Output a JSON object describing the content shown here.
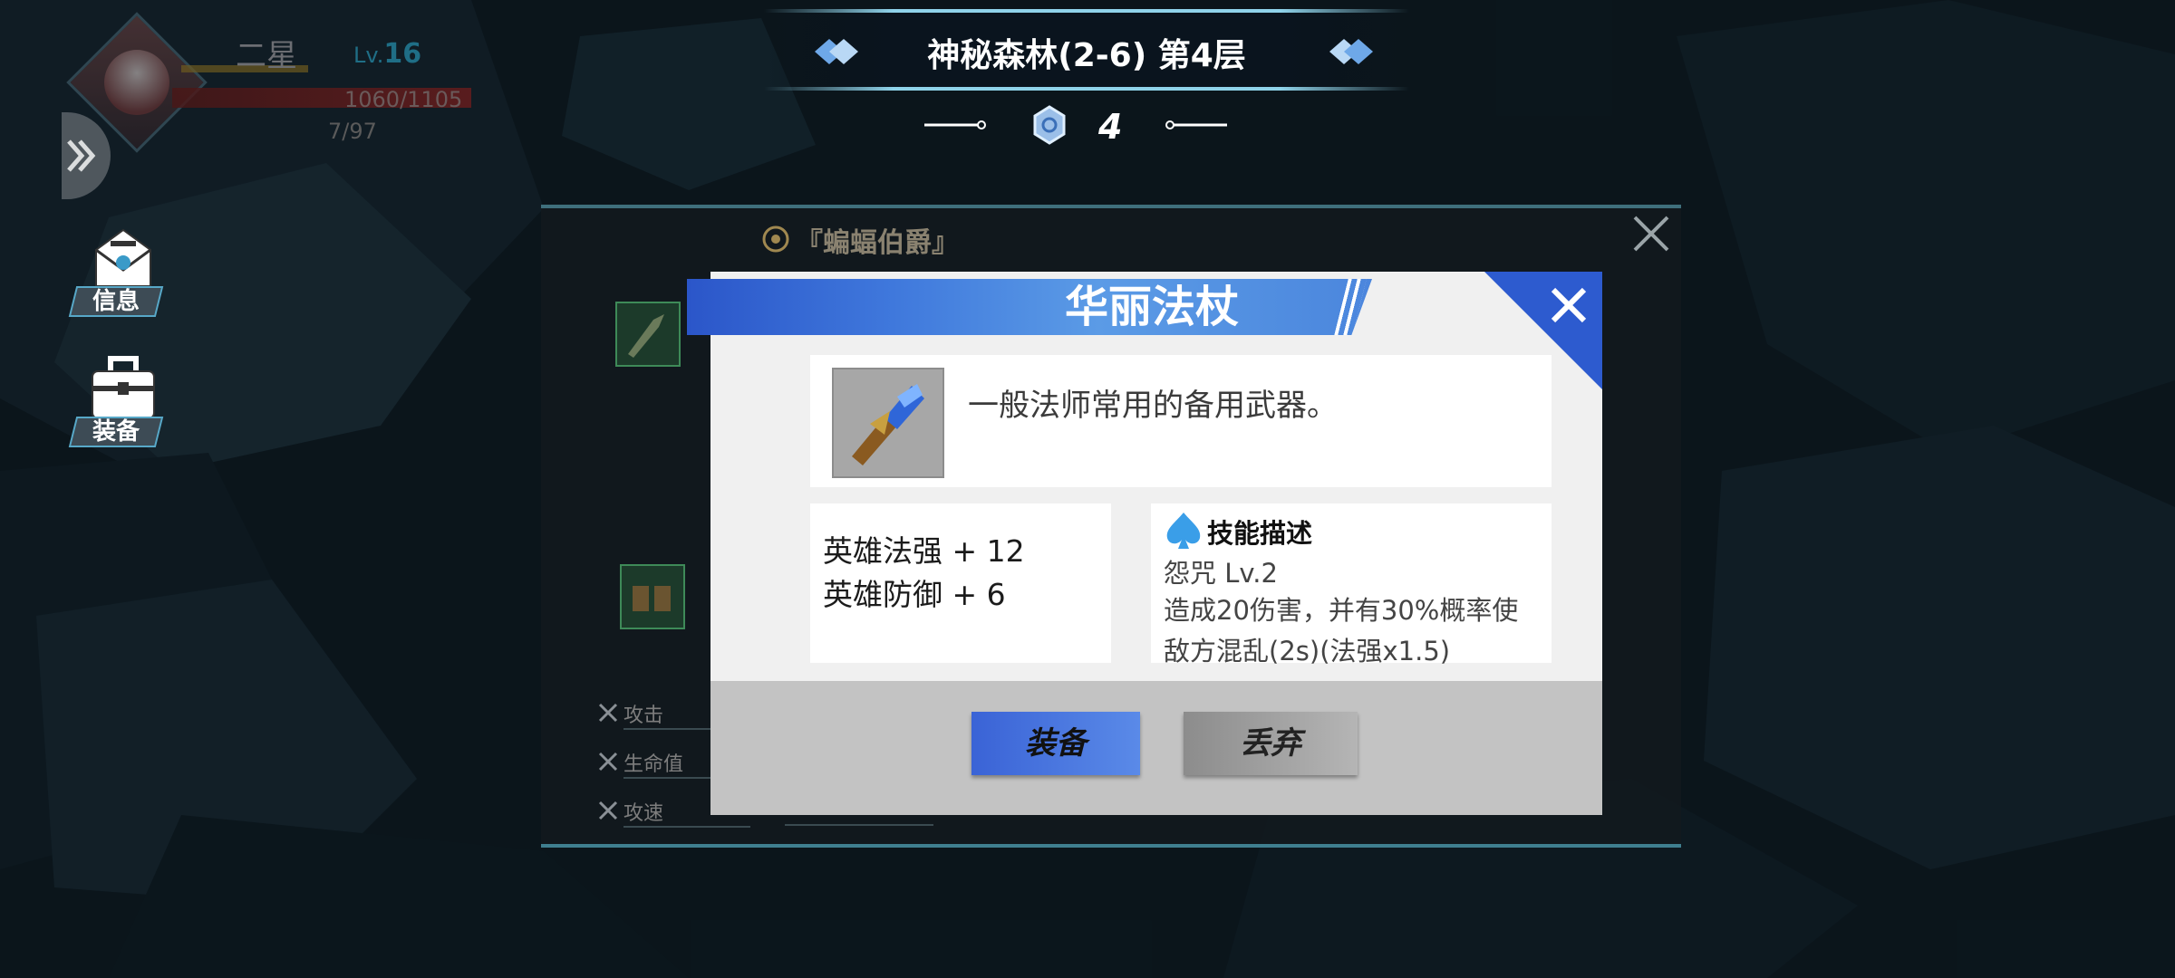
{
  "hud": {
    "star_label": "二星",
    "level_prefix": "Lv.",
    "level": "16",
    "hp_text": "1060/1105",
    "mp_text": "7/97"
  },
  "side_buttons": {
    "info_label": "信息",
    "equip_label": "装备"
  },
  "stage": {
    "title": "神秘森林(2-6) 第4层",
    "key_count": "4"
  },
  "background_panel": {
    "title": "『蝙蝠伯爵』",
    "stats": [
      "攻击",
      "生命值",
      "攻速"
    ]
  },
  "item_dialog": {
    "name": "华丽法杖",
    "description": "一般法师常用的备用武器。",
    "attributes": [
      "英雄法强 + 12",
      "英雄防御 + 6"
    ],
    "skill_header": "技能描述",
    "skill_name": "怨咒 Lv.2",
    "skill_desc": "造成20伤害，并有30%概率使敌方混乱(2s)(法强x1.5)",
    "equip_button": "装备",
    "discard_button": "丢弃"
  },
  "colors": {
    "accent_blue": "#3f78dc",
    "frame_teal": "#3f7f8f"
  }
}
